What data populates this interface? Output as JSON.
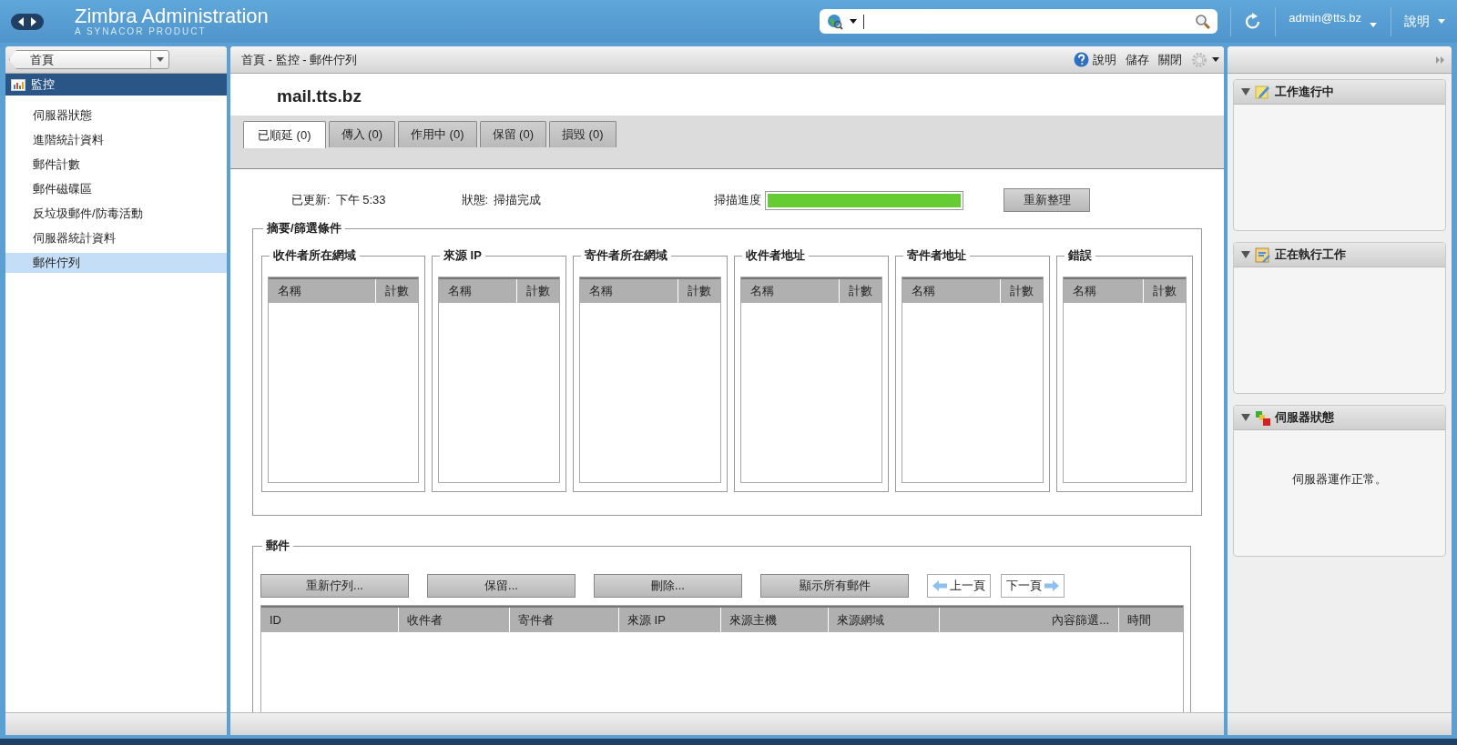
{
  "header": {
    "logo_title": "Zimbra Administration",
    "logo_subtitle": "A SYNACOR PRODUCT",
    "user": "admin@tts.bz",
    "help": "說明"
  },
  "sidebar": {
    "home": "首頁",
    "tree": [
      {
        "label": "監控",
        "children": [
          {
            "label": "伺服器狀態",
            "selected": false
          },
          {
            "label": "進階統計資料",
            "selected": false
          },
          {
            "label": "郵件計數",
            "selected": false
          },
          {
            "label": "郵件磁碟區",
            "selected": false
          },
          {
            "label": "反垃圾郵件/防毒活動",
            "selected": false
          },
          {
            "label": "伺服器統計資料",
            "selected": false
          },
          {
            "label": "郵件佇列",
            "selected": true
          }
        ]
      }
    ]
  },
  "main": {
    "breadcrumb": "首頁 - 監控 - 郵件佇列",
    "toolbar": [
      "說明",
      "儲存",
      "關閉"
    ],
    "title": "mail.tts.bz",
    "tabs": [
      {
        "label": "已順延 (0)",
        "selected": true
      },
      {
        "label": "傳入 (0)",
        "selected": false
      },
      {
        "label": "作用中 (0)",
        "selected": false
      },
      {
        "label": "保留 (0)",
        "selected": false
      },
      {
        "label": "損毀 (0)",
        "selected": false
      }
    ],
    "updated_label": "已更新:",
    "updated_value": "下午 5:33",
    "status_label": "狀態:",
    "status_value": "掃描完成",
    "progress_label": "掃描進度",
    "progress": {
      "level": 1
    },
    "refresh_button": "重新整理",
    "summary": {
      "legend": "摘要/篩選條件",
      "groups": [
        {
          "title": "收件者所在網域",
          "columns": [
            "名稱",
            "計數"
          ]
        },
        {
          "title": "來源 IP",
          "columns": [
            "名稱",
            "計數"
          ]
        },
        {
          "title": "寄件者所在網域",
          "columns": [
            "名稱",
            "計數"
          ]
        },
        {
          "title": "收件者地址",
          "columns": [
            "名稱",
            "計數"
          ]
        },
        {
          "title": "寄件者地址",
          "columns": [
            "名稱",
            "計數"
          ]
        },
        {
          "title": "錯誤",
          "columns": [
            "名稱",
            "計數"
          ]
        }
      ]
    },
    "messages": {
      "legend": "郵件",
      "buttons": [
        "重新佇列...",
        "保留...",
        "刪除...",
        "顯示所有郵件"
      ],
      "prev": "上一頁",
      "next": "下一頁",
      "columns": [
        "ID",
        "收件者",
        "寄件者",
        "來源 IP",
        "來源主機",
        "來源網域",
        "內容篩選...",
        "時間"
      ]
    }
  },
  "right": {
    "panels": [
      {
        "kind": "progress",
        "title": "工作進行中",
        "expanded": true
      },
      {
        "kind": "tasks",
        "title": "正在執行工作",
        "expanded": true
      },
      {
        "kind": "status",
        "title": "伺服器狀態",
        "expanded": true,
        "message": "伺服器運作正常。"
      }
    ]
  }
}
